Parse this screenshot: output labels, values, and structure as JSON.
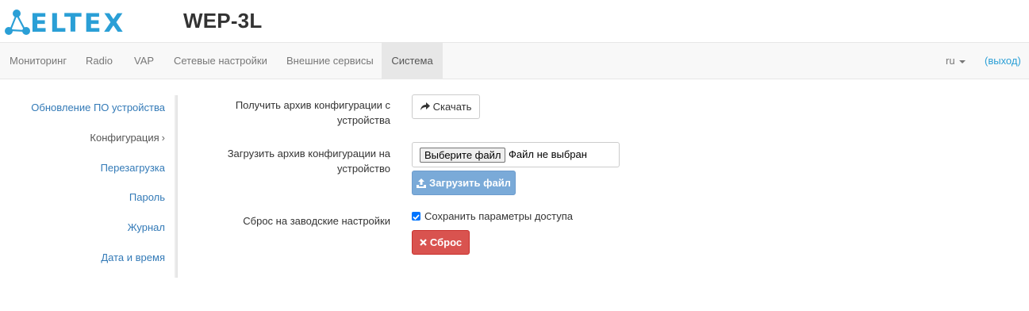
{
  "header": {
    "logo_text": "ELTEX",
    "model": "WEP-3L"
  },
  "navbar": {
    "items": [
      {
        "label": "Мониторинг"
      },
      {
        "label": "Radio"
      },
      {
        "label": "VAP"
      },
      {
        "label": "Сетевые настройки"
      },
      {
        "label": "Внешние сервисы"
      },
      {
        "label": "Система",
        "active": true
      }
    ],
    "language": "ru",
    "logout": "(выход)"
  },
  "sidebar": {
    "items": [
      {
        "label": "Обновление ПО устройства"
      },
      {
        "label": "Конфигурация",
        "active": true,
        "chevron": "›"
      },
      {
        "label": "Перезагрузка"
      },
      {
        "label": "Пароль"
      },
      {
        "label": "Журнал"
      },
      {
        "label": "Дата и время"
      }
    ]
  },
  "config": {
    "download": {
      "label_line1": "Получить архив конфигурации с",
      "label_line2": "устройства",
      "button": "Скачать"
    },
    "upload": {
      "label_line1": "Загрузить архив конфигурации на",
      "label_line2": "устройство",
      "choose_file": "Выберите файл",
      "file_status": "Файл не выбран",
      "button": "Загрузить файл"
    },
    "reset": {
      "label": "Сброс на заводские настройки",
      "keep_access": "Сохранить параметры доступа",
      "keep_access_checked": true,
      "button": "Сброс"
    }
  },
  "colors": {
    "brand": "#2a9fd6",
    "link": "#337ab7",
    "danger": "#d9534f",
    "upload_disabled": "#7aaad8",
    "navbar_bg": "#f8f8f8"
  }
}
